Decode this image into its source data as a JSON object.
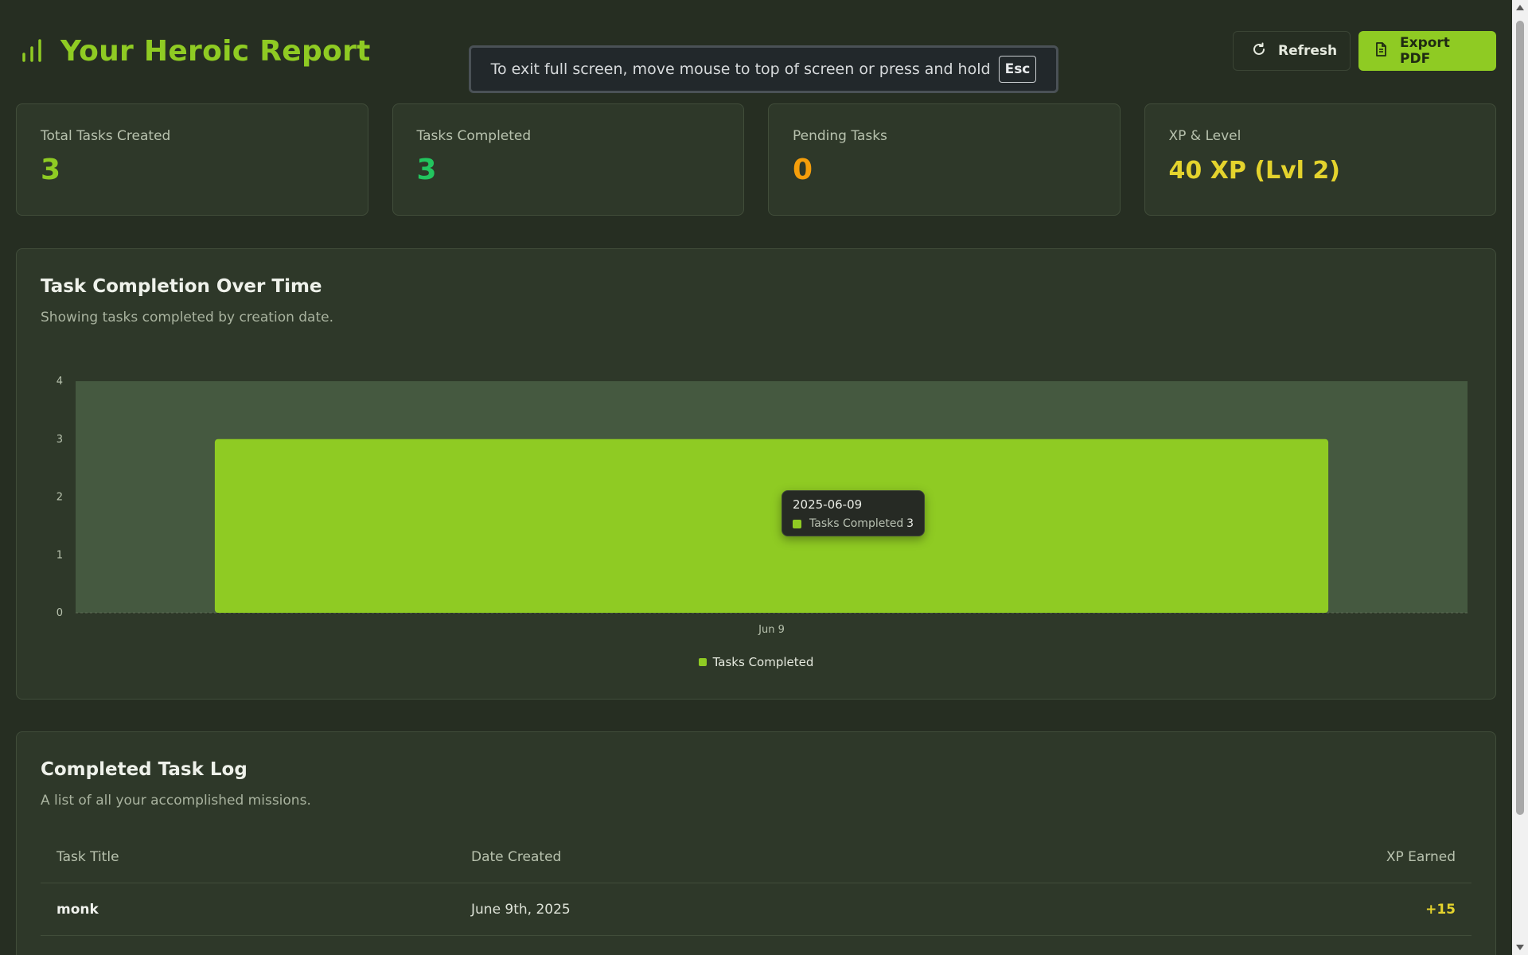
{
  "header": {
    "title": "Your Heroic Report",
    "refresh_label": "Refresh",
    "export_label": "Export PDF"
  },
  "fullscreen_notice": {
    "text": "To exit full screen, move mouse to top of screen or press and hold",
    "key": "Esc"
  },
  "stats": [
    {
      "label": "Total Tasks Created",
      "value": "3",
      "color": "#8fcb23"
    },
    {
      "label": "Tasks Completed",
      "value": "3",
      "color": "#22c55e"
    },
    {
      "label": "Pending Tasks",
      "value": "0",
      "color": "#f59e0b"
    },
    {
      "label": "XP & Level",
      "value": "40 XP (Lvl 2)",
      "color": "#e4d32d"
    }
  ],
  "chart_card": {
    "title": "Task Completion Over Time",
    "subtitle": "Showing tasks completed by creation date."
  },
  "chart_data": {
    "type": "bar",
    "categories": [
      "Jun 9"
    ],
    "series": [
      {
        "name": "Tasks Completed",
        "values": [
          3
        ],
        "color": "#8fcb23"
      }
    ],
    "ylim": [
      0,
      4
    ],
    "yticks": [
      0,
      1,
      2,
      3,
      4
    ],
    "legend": "bottom-center",
    "tooltip": {
      "date": "2025-06-09",
      "series": "Tasks Completed",
      "value": "3"
    }
  },
  "task_log": {
    "title": "Completed Task Log",
    "subtitle": "A list of all your accomplished missions.",
    "columns": [
      "Task Title",
      "Date Created",
      "XP Earned"
    ],
    "rows": [
      {
        "title": "monk",
        "date": "June 9th, 2025",
        "xp": "+15"
      }
    ]
  },
  "icons": {
    "title": "bar-chart-icon",
    "refresh": "refresh-icon",
    "export": "document-icon"
  }
}
